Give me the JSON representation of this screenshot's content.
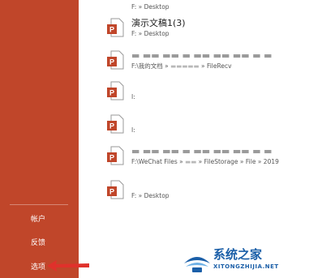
{
  "sidebar": {
    "items": [
      {
        "label": "帐户"
      },
      {
        "label": "反馈"
      },
      {
        "label": "选项"
      }
    ]
  },
  "recent_files": [
    {
      "name": "",
      "path": "F: » Desktop"
    },
    {
      "name": "演示文稿1(3)",
      "path": "F: » Desktop"
    },
    {
      "name": "",
      "path": "F:\\我的文档 »",
      "path_tail": "» FileRecv"
    },
    {
      "name": "",
      "path": "I:"
    },
    {
      "name": "",
      "path": "I:"
    },
    {
      "name": "",
      "path": "F:\\WeChat Files »",
      "path_tail": "» FileStorage » File » 2019"
    },
    {
      "name": "",
      "path": "F: » Desktop"
    }
  ],
  "watermark": {
    "title": "系统之家",
    "subtitle": "XITONGZHIJIA.NET"
  },
  "colors": {
    "sidebar": "#c0462a",
    "file_icon": "#c0462a",
    "arrow": "#e0312b",
    "watermark": "#1b5fa8"
  }
}
